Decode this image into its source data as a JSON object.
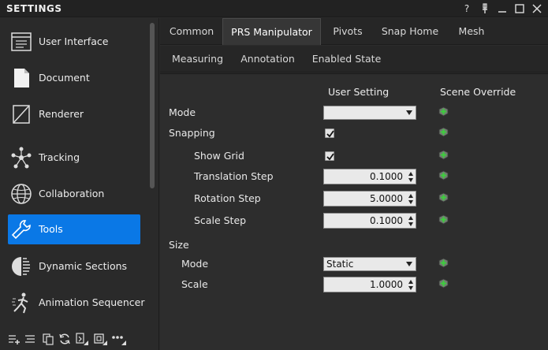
{
  "window": {
    "title": "SETTINGS",
    "controls": {
      "help": "?",
      "pin_icon": "pin-icon",
      "minimize_icon": "minimize-icon",
      "maximize_icon": "maximize-icon",
      "close_icon": "close-icon"
    }
  },
  "sidebar": {
    "items": [
      {
        "label": "User Interface",
        "icon": "user-interface-icon"
      },
      {
        "label": "Document",
        "icon": "document-icon"
      },
      {
        "label": "Renderer",
        "icon": "renderer-icon"
      },
      {
        "label": "Tracking",
        "icon": "tracking-icon"
      },
      {
        "label": "Collaboration",
        "icon": "collaboration-icon"
      },
      {
        "label": "Tools",
        "icon": "tools-icon",
        "active": true
      },
      {
        "label": "Dynamic Sections",
        "icon": "dynamic-sections-icon"
      },
      {
        "label": "Animation Sequencer",
        "icon": "animation-sequencer-icon"
      }
    ],
    "toolbar": [
      "add-icon",
      "list-icon",
      "copy-icon",
      "refresh-icon",
      "import-icon",
      "export-icon",
      "more-icon"
    ]
  },
  "tabs": {
    "row1": [
      "Common",
      "PRS Manipulator",
      "Pivots",
      "Snap Home",
      "Mesh"
    ],
    "row2": [
      "Measuring",
      "Annotation",
      "Enabled State"
    ],
    "active": "PRS Manipulator"
  },
  "settings": {
    "col_user": "User Setting",
    "col_scene": "Scene Override",
    "mode_label": "Mode",
    "mode_value": "",
    "snapping_label": "Snapping",
    "snapping_checked": true,
    "show_grid_label": "Show Grid",
    "show_grid_checked": true,
    "translation_step_label": "Translation Step",
    "translation_step_value": "0.1000",
    "rotation_step_label": "Rotation Step",
    "rotation_step_value": "5.0000",
    "scale_step_label": "Scale Step",
    "scale_step_value": "0.1000",
    "size_label": "Size",
    "size_mode_label": "Mode",
    "size_mode_value": "Static",
    "size_scale_label": "Scale",
    "size_scale_value": "1.0000"
  },
  "colors": {
    "accent": "#0a78e6",
    "override_green": "#3ccf3c"
  }
}
